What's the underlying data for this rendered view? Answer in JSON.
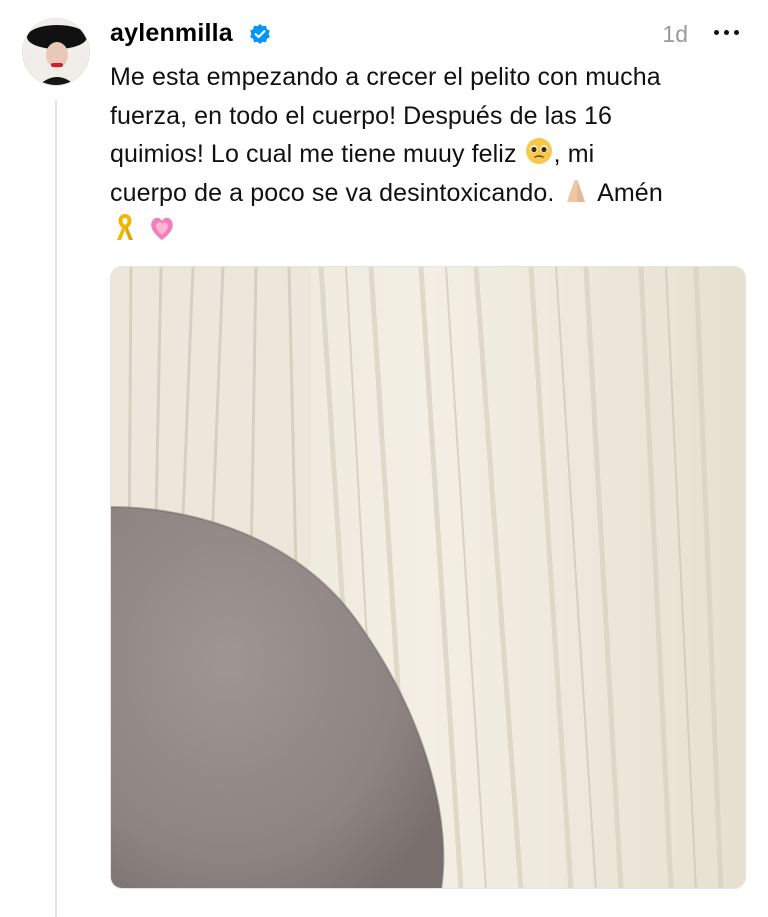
{
  "post": {
    "username": "aylenmilla",
    "verified": true,
    "timestamp": "1d",
    "text_lines": [
      "Me esta empezando a crecer el pelito con mucha",
      "fuerza, en todo el cuerpo! Después de las 16",
      "quimios! Lo cual me tiene muuy feliz",
      ", mi",
      "cuerpo de a poco se va desintoxicando.",
      "Amén"
    ],
    "emojis": [
      "pleading-face-emoji",
      "folded-hands-emoji",
      "yellow-ribbon-emoji",
      "growing-heart-emoji"
    ]
  },
  "colors": {
    "verified_badge": "#0095f6",
    "timestamp": "#9a9a9a",
    "thread_line": "#e3e3e3"
  },
  "icons": {
    "verified": "verified-badge-icon",
    "more": "more-options-icon"
  }
}
